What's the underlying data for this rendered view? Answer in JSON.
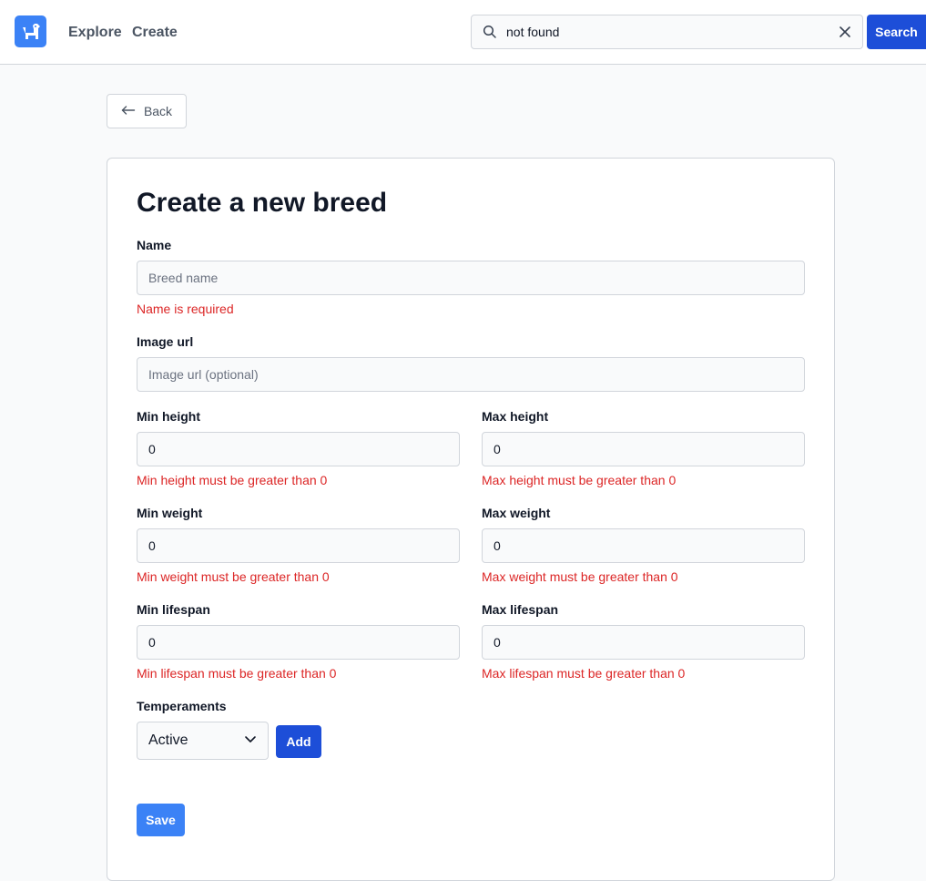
{
  "header": {
    "nav": [
      {
        "label": "Explore"
      },
      {
        "label": "Create"
      }
    ],
    "search": {
      "value": "not found",
      "button_label": "Search"
    }
  },
  "page": {
    "back_label": "Back",
    "title": "Create a new breed"
  },
  "form": {
    "name": {
      "label": "Name",
      "placeholder": "Breed name",
      "value": "",
      "error": "Name is required"
    },
    "image_url": {
      "label": "Image url",
      "placeholder": "Image url (optional)",
      "value": ""
    },
    "min_height": {
      "label": "Min height",
      "value": "0",
      "error": "Min height must be greater than 0"
    },
    "max_height": {
      "label": "Max height",
      "value": "0",
      "error": "Max height must be greater than 0"
    },
    "min_weight": {
      "label": "Min weight",
      "value": "0",
      "error": "Min weight must be greater than 0"
    },
    "max_weight": {
      "label": "Max weight",
      "value": "0",
      "error": "Max weight must be greater than 0"
    },
    "min_lifespan": {
      "label": "Min lifespan",
      "value": "0",
      "error": "Min lifespan must be greater than 0"
    },
    "max_lifespan": {
      "label": "Max lifespan",
      "value": "0",
      "error": "Max lifespan must be greater than 0"
    },
    "temperaments": {
      "label": "Temperaments",
      "selected": "Active",
      "add_label": "Add"
    },
    "save_label": "Save"
  },
  "icons": {
    "logo": "dog-icon",
    "search": "search-icon",
    "clear": "close-icon",
    "back": "arrow-left-icon",
    "select": "chevron-down-icon"
  },
  "colors": {
    "primary": "#1d4ed8",
    "accent": "#3b82f6",
    "error": "#dc2626"
  }
}
